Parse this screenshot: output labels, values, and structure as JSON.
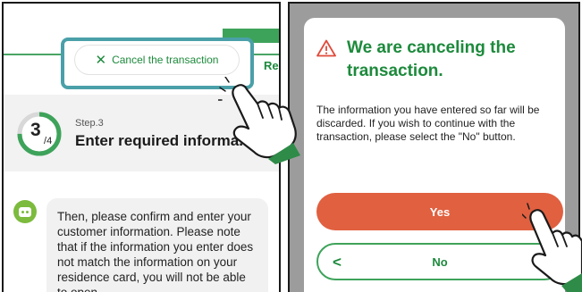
{
  "left_screen": {
    "header_partial_text": "Re",
    "cancel_button": {
      "label": "Cancel the transaction",
      "icon": "close-icon"
    },
    "step": {
      "current": "3",
      "total": "4",
      "progress_fraction": 0.75,
      "label": "Step.3",
      "title": "Enter required informa..."
    },
    "chat": {
      "avatar_icon": "robot-icon",
      "message": "Then, please confirm and enter your customer information. Please note that if the information you enter does not match the information on your residence card, you will not be able to open"
    }
  },
  "right_screen": {
    "dialog": {
      "icon": "warning-icon",
      "title": "We are canceling the transaction.",
      "body": "The information you have entered so far will be discarded. If you wish to continue with the transaction, please select the \"No\" button.",
      "yes_label": "Yes",
      "no_label": "No"
    }
  },
  "colors": {
    "brand_green": "#1d8a3c",
    "accent_green": "#3ea35a",
    "yes_button": "#e06040",
    "highlight_frame": "#4aa0a8",
    "overlay_gray": "#9c9c9c",
    "hand_green": "#2e8b48"
  }
}
